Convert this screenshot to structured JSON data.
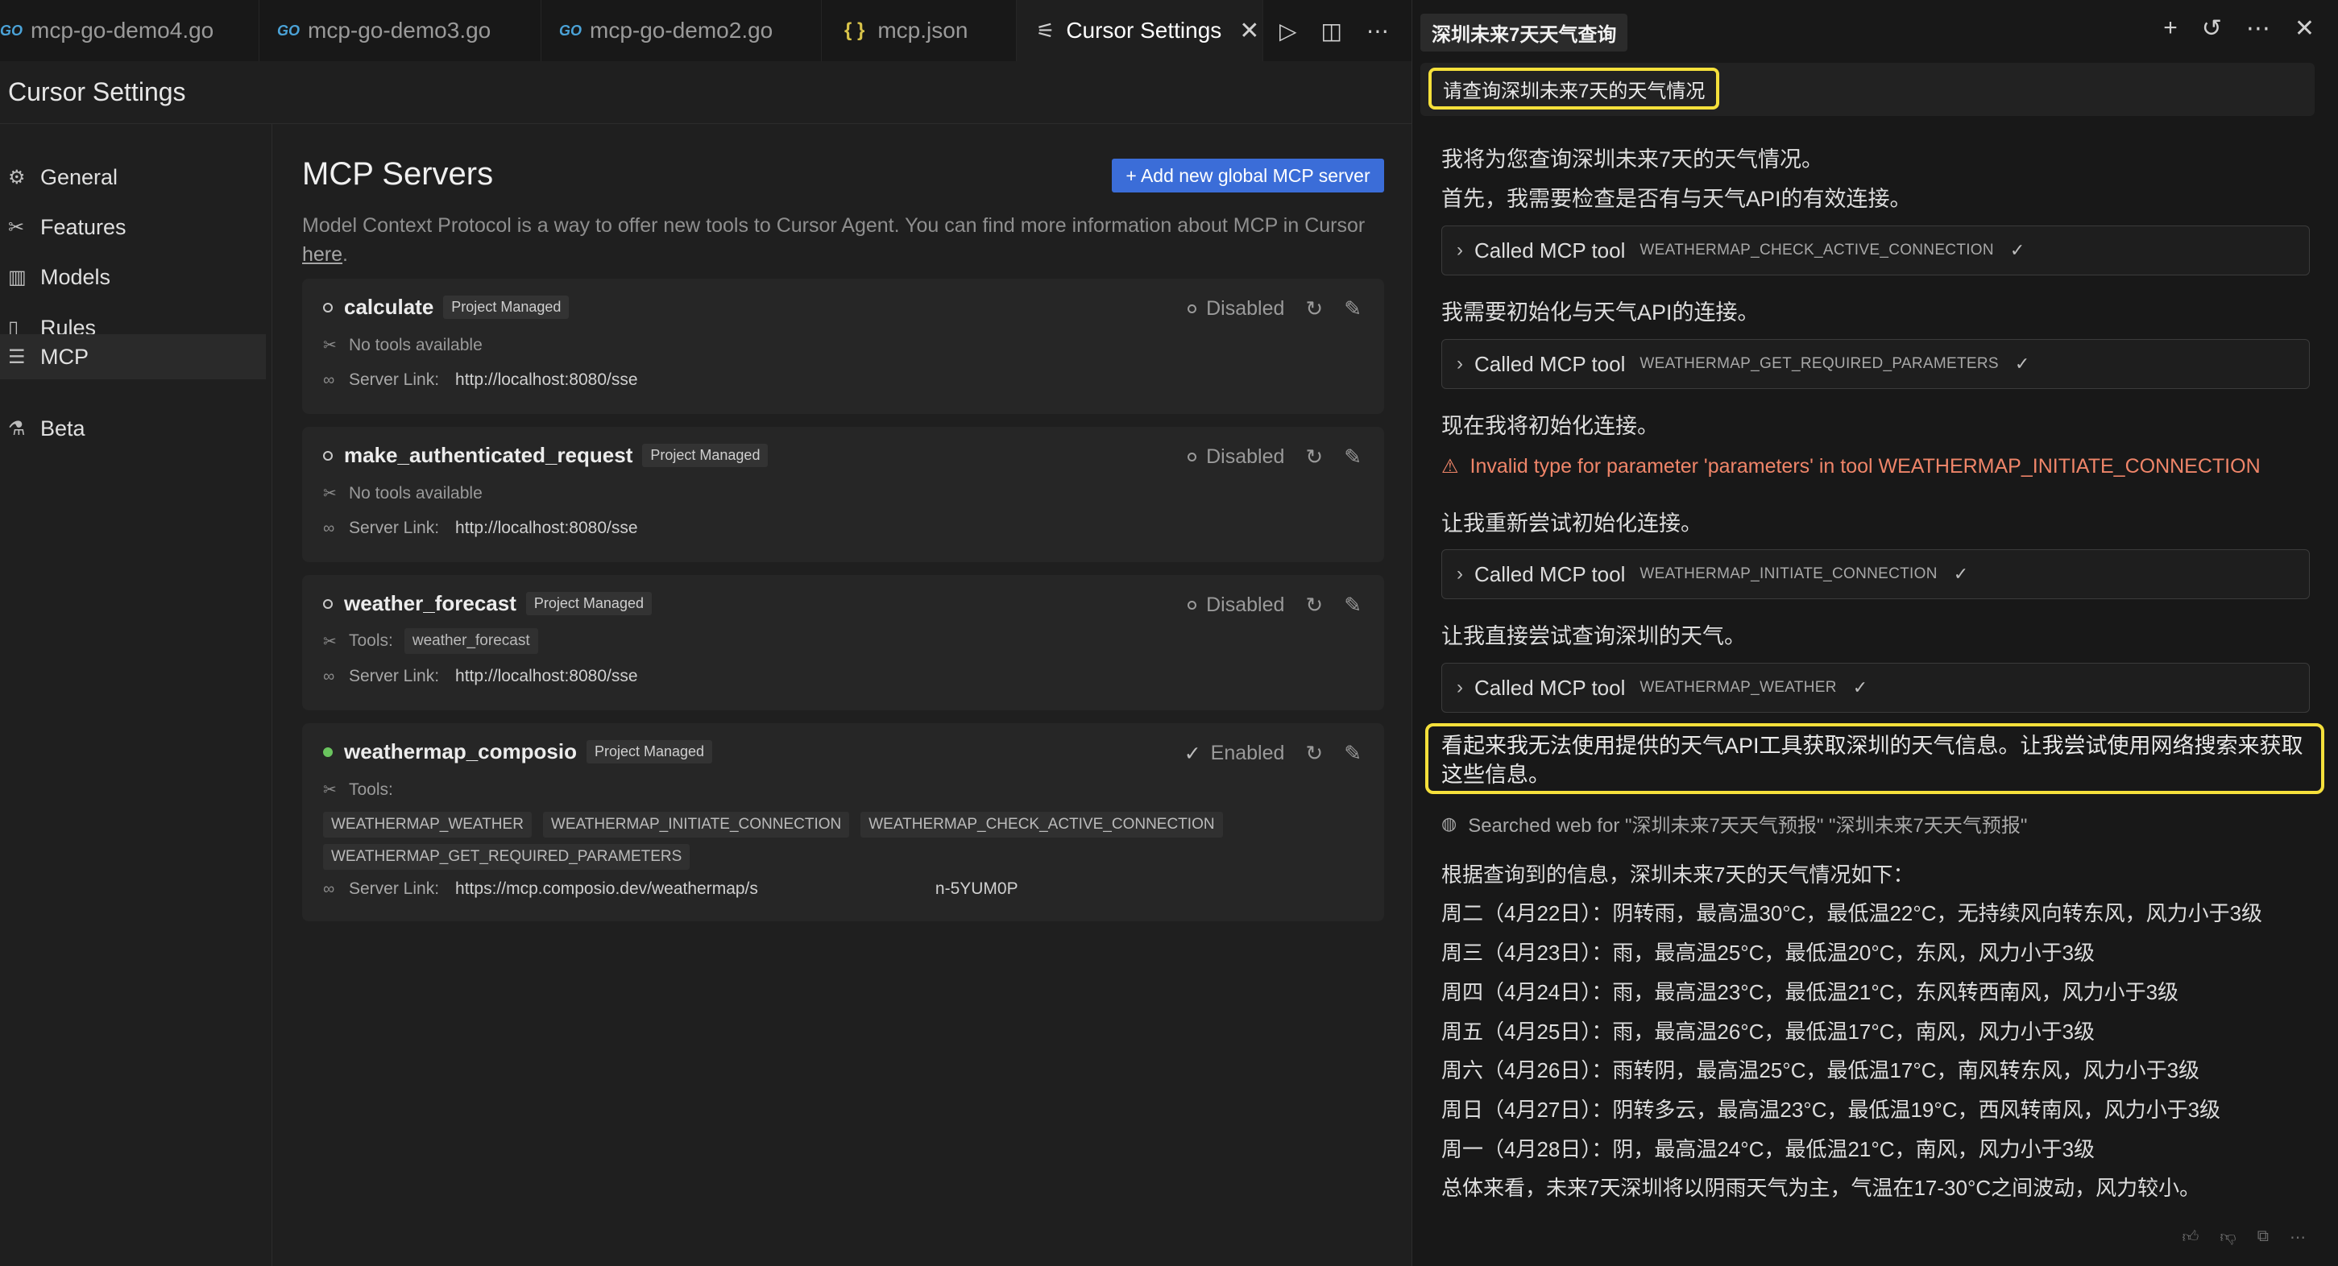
{
  "tabs": [
    {
      "label": "mcp-go-demo4.go",
      "icon": "go-icon"
    },
    {
      "label": "mcp-go-demo3.go",
      "icon": "go-icon"
    },
    {
      "label": "mcp-go-demo2.go",
      "icon": "go-icon"
    },
    {
      "label": "mcp.json",
      "icon": "json-braces-icon"
    },
    {
      "label": "Cursor Settings",
      "icon": "settings-sliders-icon",
      "active": true
    }
  ],
  "go_icon_text": "GO",
  "settings": {
    "title": "Cursor Settings",
    "nav": [
      {
        "label": "General",
        "icon": "gear-icon"
      },
      {
        "label": "Features",
        "icon": "tools-icon"
      },
      {
        "label": "Models",
        "icon": "chart-icon"
      },
      {
        "label": "Rules",
        "icon": "file-icon"
      },
      {
        "label": "MCP",
        "icon": "server-icon",
        "active": true
      },
      {
        "label": "Beta",
        "icon": "flask-icon"
      }
    ]
  },
  "mcp": {
    "heading": "MCP Servers",
    "add_button": "+ Add new global MCP server",
    "desc_before": "Model Context Protocol is a way to offer new tools to Cursor Agent. You can find more information about MCP in Cursor ",
    "desc_link": "here",
    "desc_after": ".",
    "badge": "Project Managed",
    "server_link_label": "Server Link:",
    "tools_label": "Tools:",
    "no_tools": "No tools available",
    "servers": [
      {
        "name": "calculate",
        "status": "Disabled",
        "link": "http://localhost:8080/sse"
      },
      {
        "name": "make_authenticated_request",
        "status": "Disabled",
        "link": "http://localhost:8080/sse"
      },
      {
        "name": "weather_forecast",
        "status": "Disabled",
        "tool": "weather_forecast",
        "link": "http://localhost:8080/sse"
      },
      {
        "name": "weathermap_composio",
        "status": "Enabled",
        "tools": [
          "WEATHERMAP_WEATHER",
          "WEATHERMAP_INITIATE_CONNECTION",
          "WEATHERMAP_CHECK_ACTIVE_CONNECTION",
          "WEATHERMAP_GET_REQUIRED_PARAMETERS"
        ],
        "link_start": "https://mcp.composio.dev/weathermap/s",
        "link_end": "n-5YUM0P"
      }
    ],
    "colors": {
      "accent": "#3b6dd8",
      "enabled_dot": "#6ac45e"
    }
  },
  "chat": {
    "title": "深圳未来7天天气查询",
    "query": "请查询深圳未来7天的天气情况",
    "msg1": "我将为您查询深圳未来7天的天气情况。",
    "msg2": "首先，我需要检查是否有与天气API的有效连接。",
    "called_label": "Called MCP tool",
    "tool1": "WEATHERMAP_CHECK_ACTIVE_CONNECTION",
    "msg3": "我需要初始化与天气API的连接。",
    "tool2": "WEATHERMAP_GET_REQUIRED_PARAMETERS",
    "msg4": "现在我将初始化连接。",
    "error": "Invalid type for parameter 'parameters' in tool WEATHERMAP_INITIATE_CONNECTION",
    "msg5": "让我重新尝试初始化连接。",
    "tool3": "WEATHERMAP_INITIATE_CONNECTION",
    "msg6": "让我直接尝试查询深圳的天气。",
    "tool4": "WEATHERMAP_WEATHER",
    "highlight": "看起来我无法使用提供的天气API工具获取深圳的天气信息。让我尝试使用网络搜索来获取这些信息。",
    "search": "Searched web for \"深圳未来7天天气预报\" \"深圳未来7天天气预报\"",
    "forecast_intro": "根据查询到的信息，深圳未来7天的天气情况如下：",
    "forecast": [
      "周二（4月22日）：阴转雨，最高温30°C，最低温22°C，无持续风向转东风，风力小于3级",
      "周三（4月23日）：雨，最高温25°C，最低温20°C，东风，风力小于3级",
      "周四（4月24日）：雨，最高温23°C，最低温21°C，东风转西南风，风力小于3级",
      "周五（4月25日）：雨，最高温26°C，最低温17°C，南风，风力小于3级",
      "周六（4月26日）：雨转阴，最高温25°C，最低温17°C，南风转东风，风力小于3级",
      "周日（4月27日）：阴转多云，最高温23°C，最低温19°C，西风转南风，风力小于3级",
      "周一（4月28日）：阴，最高温24°C，最低温21°C，南风，风力小于3级"
    ],
    "summary": "总体来看，未来7天深圳将以阴雨天气为主，气温在17-30°C之间波动，风力较小。",
    "colors": {
      "highlight": "#f5e03b",
      "error": "#ef8569"
    }
  }
}
